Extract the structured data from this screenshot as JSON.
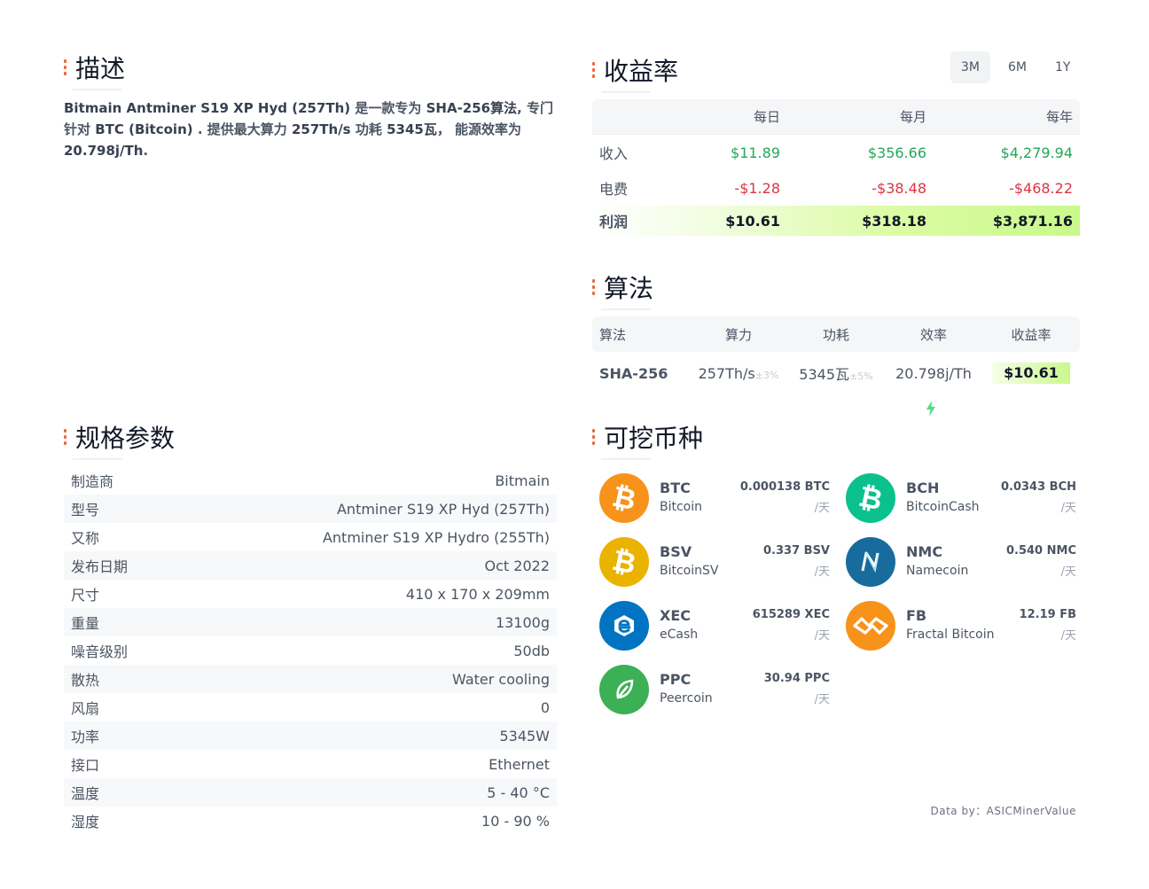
{
  "description": {
    "title": "描述",
    "parts": [
      {
        "text": "Bitmain Antminer S19 XP Hyd (257Th)",
        "bold": true
      },
      {
        "text": " 是一款专为 ",
        "bold": false
      },
      {
        "text": "SHA-256算法",
        "bold": true
      },
      {
        "text": ", 专门针对 ",
        "bold": false
      },
      {
        "text": "BTC (Bitcoin)",
        "bold": true
      },
      {
        "text": " . 提供最大算力 ",
        "bold": false
      },
      {
        "text": "257Th/s",
        "bold": true
      },
      {
        "text": " 功耗 ",
        "bold": false
      },
      {
        "text": "5345瓦",
        "bold": true
      },
      {
        "text": "， 能源效率为 ",
        "bold": false
      },
      {
        "text": "20.798j/Th",
        "bold": true
      },
      {
        "text": ".",
        "bold": false
      }
    ]
  },
  "specs": {
    "title": "规格参数",
    "rows": [
      {
        "label": "制造商",
        "value": "Bitmain"
      },
      {
        "label": "型号",
        "value": "Antminer S19 XP Hyd (257Th)"
      },
      {
        "label": "又称",
        "value": "Antminer S19 XP Hydro (255Th)"
      },
      {
        "label": "发布日期",
        "value": "Oct 2022"
      },
      {
        "label": "尺寸",
        "value": "410 x 170 x 209mm"
      },
      {
        "label": "重量",
        "value": "13100g"
      },
      {
        "label": "噪音级别",
        "value": "50db"
      },
      {
        "label": "散热",
        "value": "Water cooling"
      },
      {
        "label": "风扇",
        "value": "0"
      },
      {
        "label": "功率",
        "value": "5345W"
      },
      {
        "label": "接口",
        "value": "Ethernet"
      },
      {
        "label": "温度",
        "value": "5 - 40 °C"
      },
      {
        "label": "湿度",
        "value": "10 - 90 %"
      }
    ]
  },
  "profitability": {
    "title": "收益率",
    "tabs": [
      {
        "label": "3M",
        "active": true
      },
      {
        "label": "6M",
        "active": false
      },
      {
        "label": "1Y",
        "active": false
      }
    ],
    "headers": [
      "",
      "每日",
      "每月",
      "每年"
    ],
    "income": {
      "label": "收入",
      "daily": "$11.89",
      "monthly": "$356.66",
      "yearly": "$4,279.94"
    },
    "electricity": {
      "label": "电费",
      "daily": "-$1.28",
      "monthly": "-$38.48",
      "yearly": "-$468.22"
    },
    "profit": {
      "label": "利润",
      "daily": "$10.61",
      "monthly": "$318.18",
      "yearly": "$3,871.16"
    }
  },
  "algorithm": {
    "title": "算法",
    "headers": [
      "算法",
      "算力",
      "功耗",
      "效率",
      "收益率"
    ],
    "row": {
      "name": "SHA-256",
      "hashrate": "257Th/s",
      "hashrate_tol": "±3%",
      "power": "5345瓦",
      "power_tol": "±5%",
      "efficiency": "20.798j/Th",
      "revenue": "$10.61"
    }
  },
  "coins": {
    "title": "可挖币种",
    "per_day": "/天",
    "items": [
      {
        "symbol": "BTC",
        "name": "Bitcoin",
        "amount": "0.000138 BTC",
        "color": "#f7931a",
        "icon": "bitcoin-icon",
        "glyph": "₿"
      },
      {
        "symbol": "BCH",
        "name": "BitcoinCash",
        "amount": "0.0343 BCH",
        "color": "#0ac18e",
        "icon": "bitcoincash-icon",
        "glyph": "₿"
      },
      {
        "symbol": "BSV",
        "name": "BitcoinSV",
        "amount": "0.337 BSV",
        "color": "#eab300",
        "icon": "bitcoinsv-icon",
        "glyph": "₿"
      },
      {
        "symbol": "NMC",
        "name": "Namecoin",
        "amount": "0.540 NMC",
        "color": "#186c9d",
        "icon": "namecoin-icon",
        "glyph": "N"
      },
      {
        "symbol": "XEC",
        "name": "eCash",
        "amount": "615289 XEC",
        "color": "#0074c2",
        "icon": "ecash-icon",
        "glyph": "e"
      },
      {
        "symbol": "FB",
        "name": "Fractal Bitcoin",
        "amount": "12.19 FB",
        "color": "#f7931a",
        "icon": "fractal-bitcoin-icon",
        "glyph": "◈"
      },
      {
        "symbol": "PPC",
        "name": "Peercoin",
        "amount": "30.94 PPC",
        "color": "#3cb054",
        "icon": "peercoin-icon",
        "glyph": "leaf"
      }
    ]
  },
  "credit": "Data by：ASICMinerValue"
}
